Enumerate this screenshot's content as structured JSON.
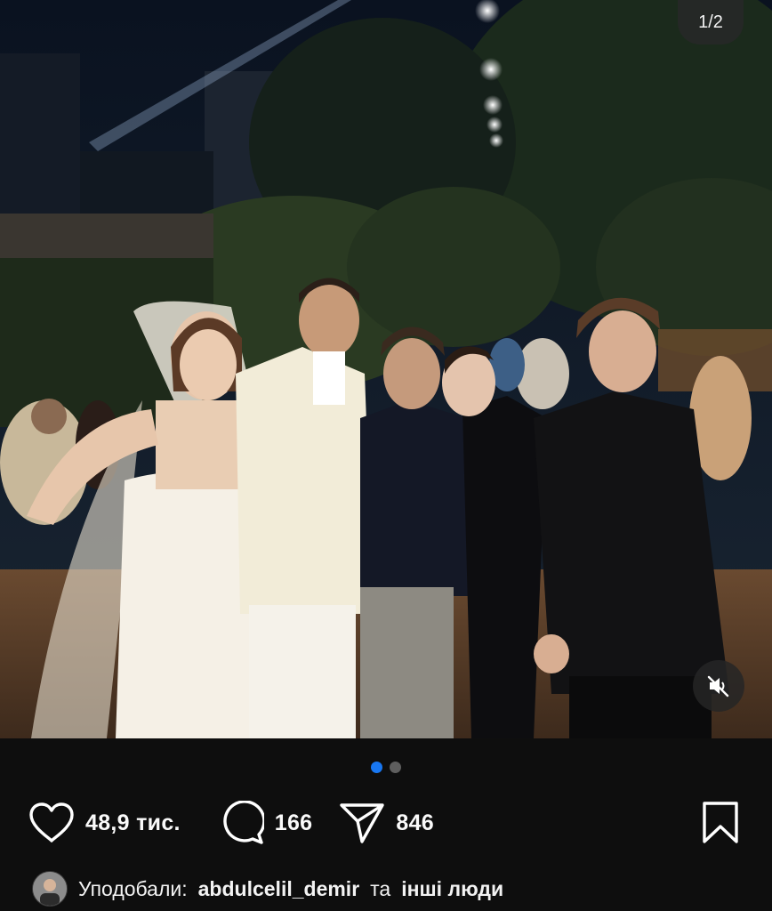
{
  "post": {
    "page_counter": "1/2",
    "media_index": 1,
    "media_total": 2,
    "photo_subject": "wedding group photo at night"
  },
  "actions": {
    "likes": "48,9 тис.",
    "comments": "166",
    "shares": "846"
  },
  "liked_by": {
    "prefix": "Уподобали:",
    "username": "abdulcelil_demir",
    "connector": "та",
    "others": "інші люди"
  },
  "colors": {
    "background": "#0e0e0e",
    "active_dot": "#1877f2",
    "inactive_dot": "#5e5e5e",
    "text": "#fafafa"
  },
  "icons": [
    "heart-icon",
    "comment-icon",
    "share-icon",
    "bookmark-icon",
    "muted-speaker-icon"
  ]
}
